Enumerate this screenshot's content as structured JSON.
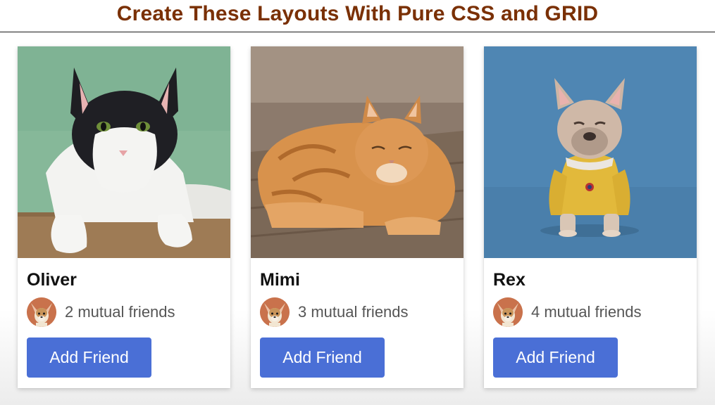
{
  "banner": {
    "title": "Create These Layouts With Pure CSS and GRID"
  },
  "colors": {
    "title": "#7a3005",
    "button": "#4a6fd6",
    "button_text": "#ffffff",
    "muted_text": "#555555"
  },
  "cards": [
    {
      "name": "Oliver",
      "mutual": "2 mutual friends",
      "button": "Add Friend",
      "photo": "black-white-cat"
    },
    {
      "name": "Mimi",
      "mutual": "3 mutual friends",
      "button": "Add Friend",
      "photo": "orange-tabby-cat"
    },
    {
      "name": "Rex",
      "mutual": "4 mutual friends",
      "button": "Add Friend",
      "photo": "french-bulldog-in-sweater"
    }
  ],
  "avatar": {
    "icon": "chihuahua-avatar"
  }
}
